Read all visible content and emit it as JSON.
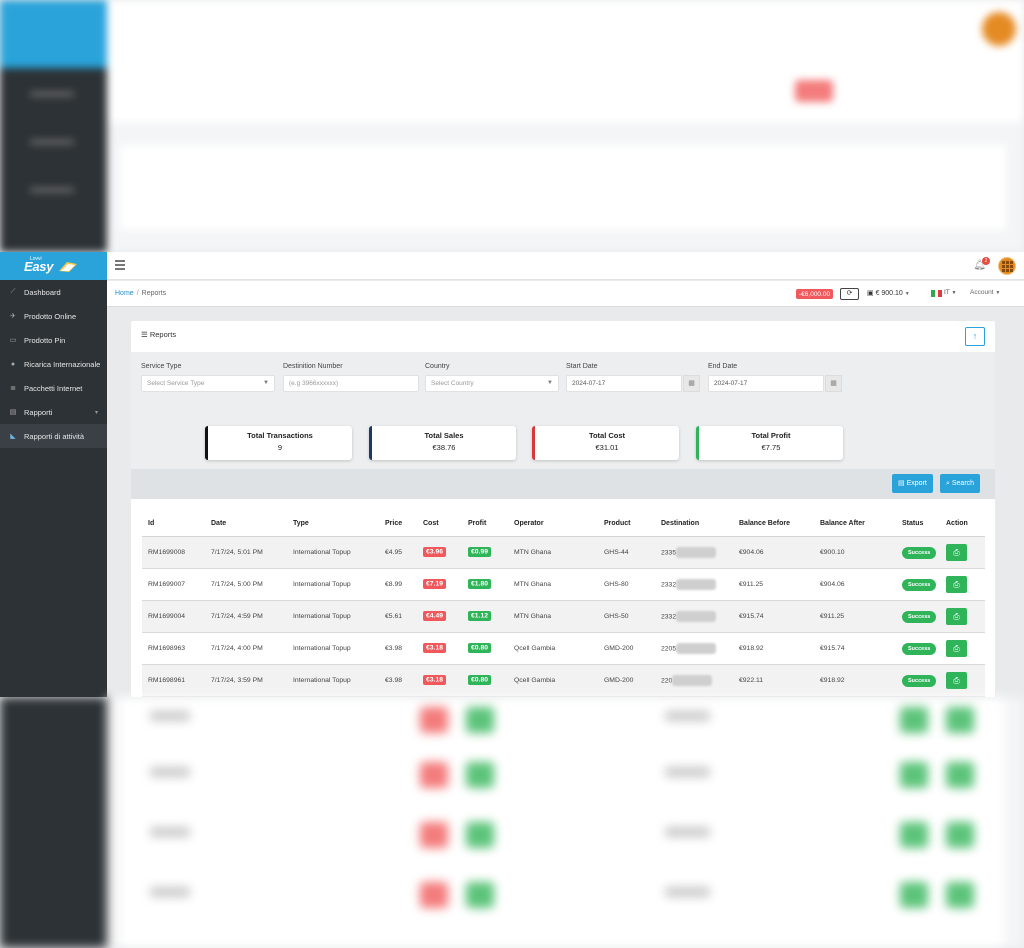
{
  "brand": {
    "logo_small": "Lovvi",
    "logo_main": "Easy"
  },
  "sidebar": {
    "items": [
      {
        "label": "Dashboard",
        "icon": "chart-line-icon"
      },
      {
        "label": "Prodotto Online",
        "icon": "plane-icon"
      },
      {
        "label": "Prodotto Pin",
        "icon": "card-icon"
      },
      {
        "label": "Ricarica Internazionale",
        "icon": "globe-icon"
      },
      {
        "label": "Pacchetti Internet",
        "icon": "list-icon"
      },
      {
        "label": "Rapporti",
        "icon": "clipboard-icon"
      },
      {
        "label": "Rapporti di attività",
        "icon": "chart-area-icon"
      }
    ]
  },
  "topbar": {
    "notifications_count": "2"
  },
  "subbar": {
    "breadcrumb_home": "Home",
    "breadcrumb_sep": "/",
    "breadcrumb_current": "Reports",
    "debt": "-€6,000.00",
    "wallet": "€ 900.10",
    "language": "IT",
    "account": "Account"
  },
  "card": {
    "title": "Reports"
  },
  "filters": {
    "service_type": {
      "label": "Service Type",
      "placeholder": "Select Service Type"
    },
    "destination": {
      "label": "Destinition Number",
      "placeholder": "(e.g 3966xxxxxx)"
    },
    "country": {
      "label": "Country",
      "placeholder": "Select Country"
    },
    "start_date": {
      "label": "Start Date",
      "value": "2024-07-17"
    },
    "end_date": {
      "label": "End Date",
      "value": "2024-07-17"
    }
  },
  "stats": [
    {
      "label": "Total Transactions",
      "value": "9",
      "color": "#111111"
    },
    {
      "label": "Total Sales",
      "value": "€38.76",
      "color": "#1b3a6b"
    },
    {
      "label": "Total Cost",
      "value": "€31.01",
      "color": "#d9383b"
    },
    {
      "label": "Total Profit",
      "value": "€7.75",
      "color": "#2fb45a"
    }
  ],
  "actions": {
    "export": "Export",
    "search": "Search"
  },
  "table": {
    "headers": [
      "Id",
      "Date",
      "Type",
      "Price",
      "Cost",
      "Profit",
      "Operator",
      "Product",
      "Destination",
      "Balance Before",
      "Balance After",
      "Status",
      "Action"
    ],
    "rows": [
      {
        "id": "RM1699008",
        "date": "7/17/24, 5:01 PM",
        "type": "International Topup",
        "price": "€4.95",
        "cost": "€3.96",
        "profit": "€0.99",
        "operator": "MTN Ghana",
        "product": "GHS-44",
        "destination": "2335",
        "before": "€904.06",
        "after": "€900.10",
        "status": "Success"
      },
      {
        "id": "RM1699007",
        "date": "7/17/24, 5:00 PM",
        "type": "International Topup",
        "price": "€8.99",
        "cost": "€7.19",
        "profit": "€1.80",
        "operator": "MTN Ghana",
        "product": "GHS-80",
        "destination": "2332",
        "before": "€911.25",
        "after": "€904.06",
        "status": "Success"
      },
      {
        "id": "RM1699004",
        "date": "7/17/24, 4:59 PM",
        "type": "International Topup",
        "price": "€5.61",
        "cost": "€4.49",
        "profit": "€1.12",
        "operator": "MTN Ghana",
        "product": "GHS-50",
        "destination": "2332",
        "before": "€915.74",
        "after": "€911.25",
        "status": "Success"
      },
      {
        "id": "RM1698963",
        "date": "7/17/24, 4:00 PM",
        "type": "International Topup",
        "price": "€3.98",
        "cost": "€3.18",
        "profit": "€0.80",
        "operator": "Qcell Gambia",
        "product": "GMD-200",
        "destination": "2205",
        "before": "€918.92",
        "after": "€915.74",
        "status": "Success"
      },
      {
        "id": "RM1698961",
        "date": "7/17/24, 3:59 PM",
        "type": "International Topup",
        "price": "€3.98",
        "cost": "€3.18",
        "profit": "€0.80",
        "operator": "Qcell Gambia",
        "product": "GMD-200",
        "destination": "220",
        "before": "€922.11",
        "after": "€918.92",
        "status": "Success"
      }
    ]
  }
}
